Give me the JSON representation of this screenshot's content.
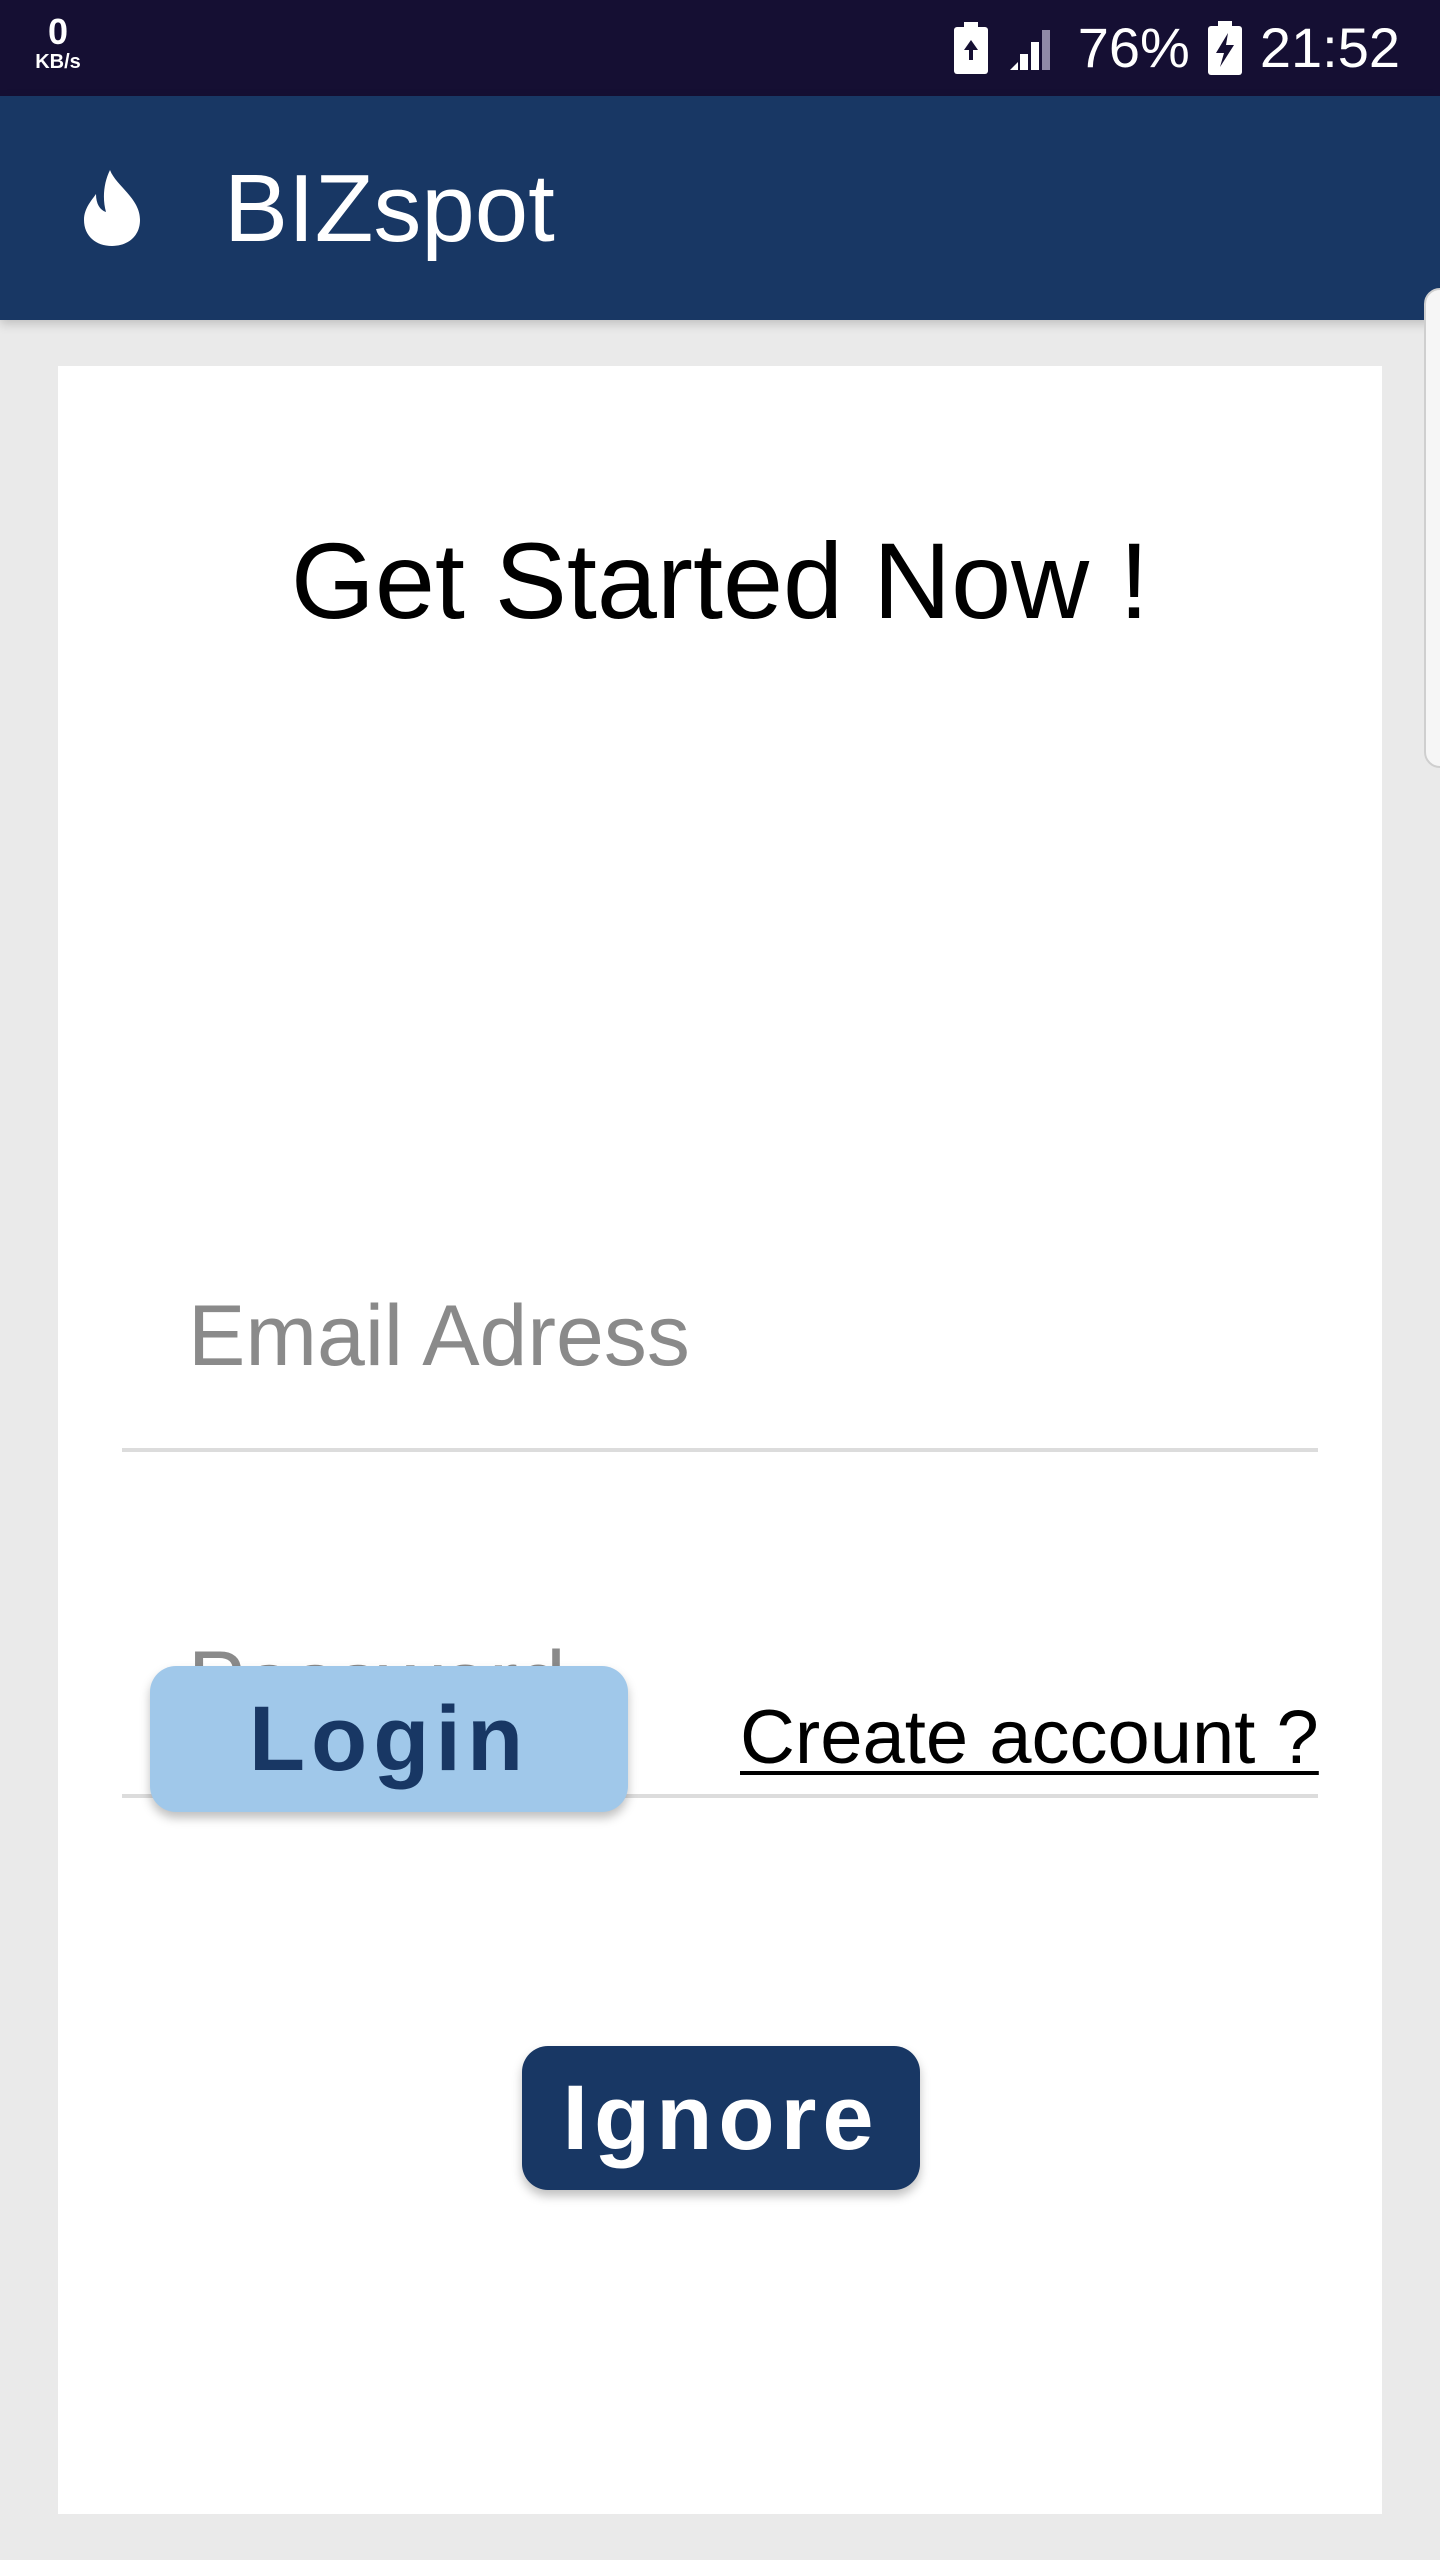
{
  "status_bar": {
    "net_speed_value": "0",
    "net_speed_unit": "KB/s",
    "battery_percent": "76%",
    "time": "21:52",
    "icons": [
      "battery-saver-icon",
      "signal-icon",
      "battery-charging-icon"
    ]
  },
  "app_bar": {
    "title": "BIZspot",
    "logo_icon": "flame-icon",
    "background_color": "#183764"
  },
  "login_card": {
    "heading": "Get Started Now !",
    "email_field": {
      "placeholder": "Email Adress",
      "value": ""
    },
    "password_field": {
      "placeholder": "Password",
      "value": ""
    },
    "login_button_label": "Login",
    "create_account_link": "Create account ?",
    "ignore_button_label": "Ignore"
  },
  "colors": {
    "primary": "#183764",
    "login_button": "#a0c8ea",
    "status_bar": "#150f33"
  }
}
